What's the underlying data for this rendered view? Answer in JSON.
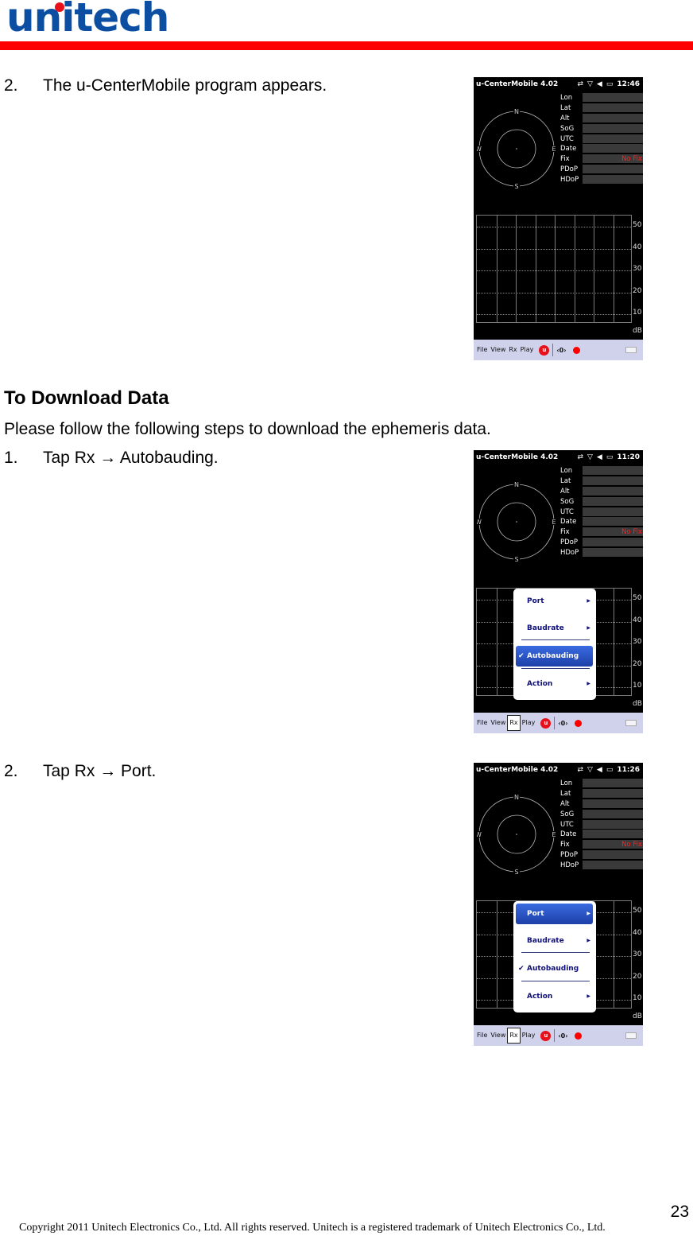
{
  "header": {
    "logo_text": "unitech"
  },
  "steps": {
    "s1": {
      "num": "2.",
      "text": "The u-CenterMobile program appears."
    },
    "heading": "To Download Data",
    "intro": "Please follow the following steps to download the ephemeris data.",
    "s2": {
      "num": "1.",
      "text": "Tap Rx  →  Autobauding."
    },
    "s3": {
      "num": "2.",
      "text": "Tap Rx  →  Port."
    }
  },
  "device_common": {
    "app_title": "u-CenterMobile 4.02",
    "compass": {
      "n": "N",
      "s": "S",
      "e": "E",
      "w": "W"
    },
    "fields": [
      "Lon",
      "Lat",
      "Alt",
      "SoG",
      "UTC",
      "Date",
      "Fix",
      "PDoP",
      "HDoP"
    ],
    "fix_value": "No Fix",
    "fix_color": "#ff2020",
    "db_ticks": [
      "50",
      "40",
      "30",
      "20",
      "10"
    ],
    "db_unit": "dB",
    "menu": [
      "File",
      "View",
      "Rx",
      "Play"
    ],
    "popup_items": [
      "Port",
      "Baudrate",
      "Autobauding",
      "Action"
    ]
  },
  "screens": [
    {
      "clock": "12:46",
      "active_menu": "",
      "popup": false,
      "selected": "",
      "checked": ""
    },
    {
      "clock": "11:20",
      "active_menu": "Rx",
      "popup": true,
      "selected": "Autobauding",
      "checked": "Autobauding"
    },
    {
      "clock": "11:26",
      "active_menu": "Rx",
      "popup": true,
      "selected": "Port",
      "checked": "Autobauding"
    }
  ],
  "footer": {
    "page_number": "23",
    "copyright": "Copyright 2011 Unitech Electronics Co., Ltd. All rights reserved. Unitech is a registered trademark of Unitech Electronics Co., Ltd."
  },
  "colors": {
    "brand_blue": "#0b4ea2",
    "brand_red": "#ff0000",
    "menu_bg": "#cfd2ea",
    "highlight": "#2a52c8"
  }
}
